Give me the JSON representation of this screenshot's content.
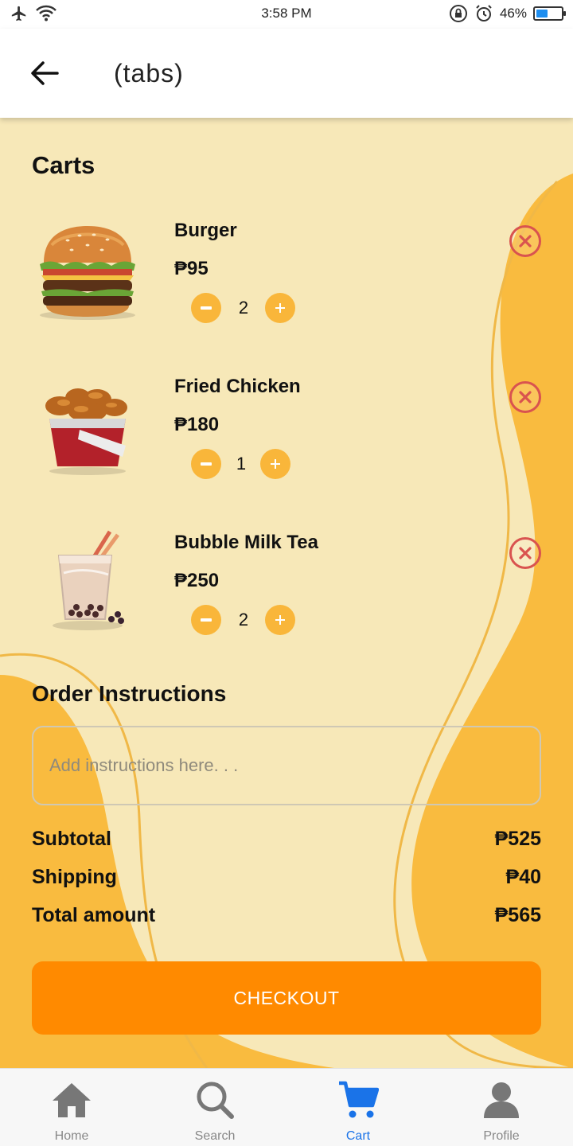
{
  "status_bar": {
    "time": "3:58 PM",
    "battery_percent": "46%",
    "battery_level": 0.46,
    "icons": [
      "airplane-icon",
      "wifi-icon",
      "rotation-lock-icon",
      "alarm-icon",
      "battery-icon"
    ]
  },
  "app_bar": {
    "title": "(tabs)",
    "back_icon": "arrow-left-icon"
  },
  "cart": {
    "title": "Carts",
    "items": [
      {
        "name": "Burger",
        "price": "₱95",
        "quantity": "2",
        "image_icon": "burger-icon"
      },
      {
        "name": "Fried Chicken",
        "price": "₱180",
        "quantity": "1",
        "image_icon": "fried-chicken-icon"
      },
      {
        "name": "Bubble Milk Tea",
        "price": "₱250",
        "quantity": "2",
        "image_icon": "bubble-tea-icon"
      }
    ]
  },
  "order_instructions": {
    "title": "Order Instructions",
    "placeholder": "Add instructions here. . .",
    "value": ""
  },
  "summary": {
    "subtotal_label": "Subtotal",
    "subtotal_value": "₱525",
    "shipping_label": "Shipping",
    "shipping_value": "₱40",
    "total_label": "Total amount",
    "total_value": "₱565"
  },
  "checkout": {
    "label": "CHECKOUT"
  },
  "bottom_nav": {
    "items": [
      {
        "label": "Home",
        "icon": "home-icon",
        "active": false
      },
      {
        "label": "Search",
        "icon": "search-icon",
        "active": false
      },
      {
        "label": "Cart",
        "icon": "cart-icon",
        "active": true
      },
      {
        "label": "Profile",
        "icon": "profile-icon",
        "active": false
      }
    ]
  },
  "colors": {
    "background": "#f7e8b8",
    "accent": "#ff8a00",
    "qty_button": "#f9b63a",
    "remove": "#d9534f",
    "active_tab": "#1a73e8"
  }
}
